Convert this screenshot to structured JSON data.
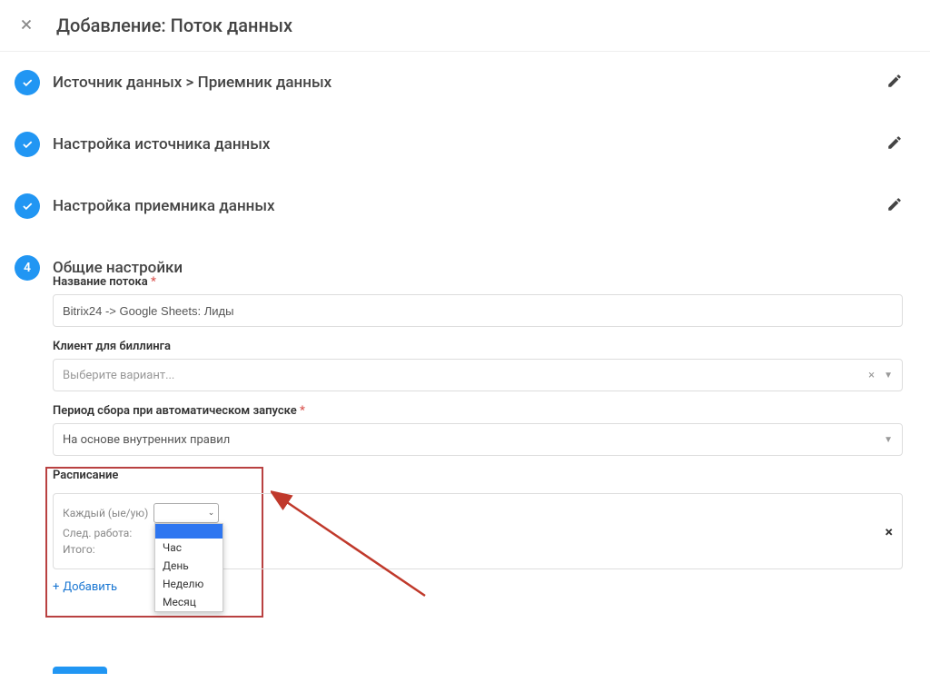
{
  "header": {
    "title": "Добавление: Поток данных"
  },
  "steps": [
    {
      "title": "Источник данных > Приемник данных",
      "done": true
    },
    {
      "title": "Настройка источника данных",
      "done": true
    },
    {
      "title": "Настройка приемника данных",
      "done": true
    }
  ],
  "step4": {
    "number": "4",
    "title": "Общие настройки",
    "name_label": "Название потока",
    "name_value": "Bitrix24 -> Google Sheets: Лиды",
    "client_label": "Клиент для биллинга",
    "client_placeholder": "Выберите вариант...",
    "period_label": "Период сбора при автоматическом запуске",
    "period_value": "На основе внутренних правил",
    "schedule": {
      "title": "Расписание",
      "every_label": "Каждый (ые/ую)",
      "next_label": "След. работа:",
      "total_label": "Итого:",
      "options": [
        "Час",
        "День",
        "Неделю",
        "Месяц"
      ],
      "add_label": "Добавить"
    }
  }
}
